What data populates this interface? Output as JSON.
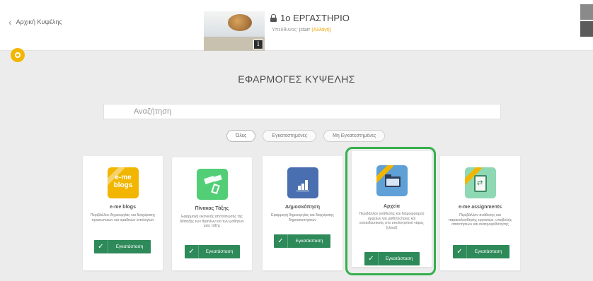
{
  "header": {
    "back_label": "Αρχική Κυψέλης",
    "hive_title": "1ο ΕΡΓΑΣΤΗΡΙΟ",
    "owner_prefix": "Υπεύθυνος:",
    "owner_name": "jstarr",
    "owner_change": "(Αλλαγή)",
    "photo_badge": "i"
  },
  "main": {
    "title": "ΕΦΑΡΜΟΓΕΣ ΚΥΨΕΛΗΣ",
    "search_placeholder": "Αναζήτηση",
    "filters": [
      "Όλες",
      "Εγκατεστημένες",
      "Μη Εγκατεστημένες"
    ],
    "active_filter": "Όλες"
  },
  "apps": [
    {
      "title": "e-me blogs",
      "description": "Περιβάλλον δημιουργίας και διαχείρισης προσωπικών και ομαδικών ιστολογίων",
      "icon": "blogs-icon",
      "icon_text": "e-me blogs",
      "button": "Εγκατάσταση",
      "ribbon": true
    },
    {
      "title": "Πίνακας Τάξης",
      "description": "Εφαρμογή εικονικής αποτύπωσης της διάταξης των θρανίων και των μαθητών μιας τάξης",
      "icon": "board-icon",
      "button": "Εγκατάσταση",
      "ribbon": false
    },
    {
      "title": "Δημοσκόπηση",
      "description": "Εφαρμογή δημιουργίας και διαχείρισης δημοσκοπήσεων",
      "icon": "poll-icon",
      "button": "Εγκατάσταση",
      "ribbon": false
    },
    {
      "title": "Αρχεία",
      "description": "Περιβάλλον ανάθεσης και διαμοιρασμού αρχείων για μαθητές/τριες και εκπαιδευτικούς στο υπολογιστικό νέφος (cloud)",
      "icon": "files-icon",
      "button": "Εγκατάσταση",
      "ribbon": true
    },
    {
      "title": "e-me assignments",
      "description": "Περιβάλλον ανάθεσης και παρακολούθησης εργασιών, υποβολής απαντήσεων και ανατροφοδότησης",
      "icon": "assign-icon",
      "button": "Εγκατάσταση",
      "ribbon": true
    }
  ],
  "colors": {
    "accent_yellow": "#f2b600",
    "install_green": "#2f8a5a",
    "highlight_green": "#35b04c",
    "background": "#ececec"
  }
}
